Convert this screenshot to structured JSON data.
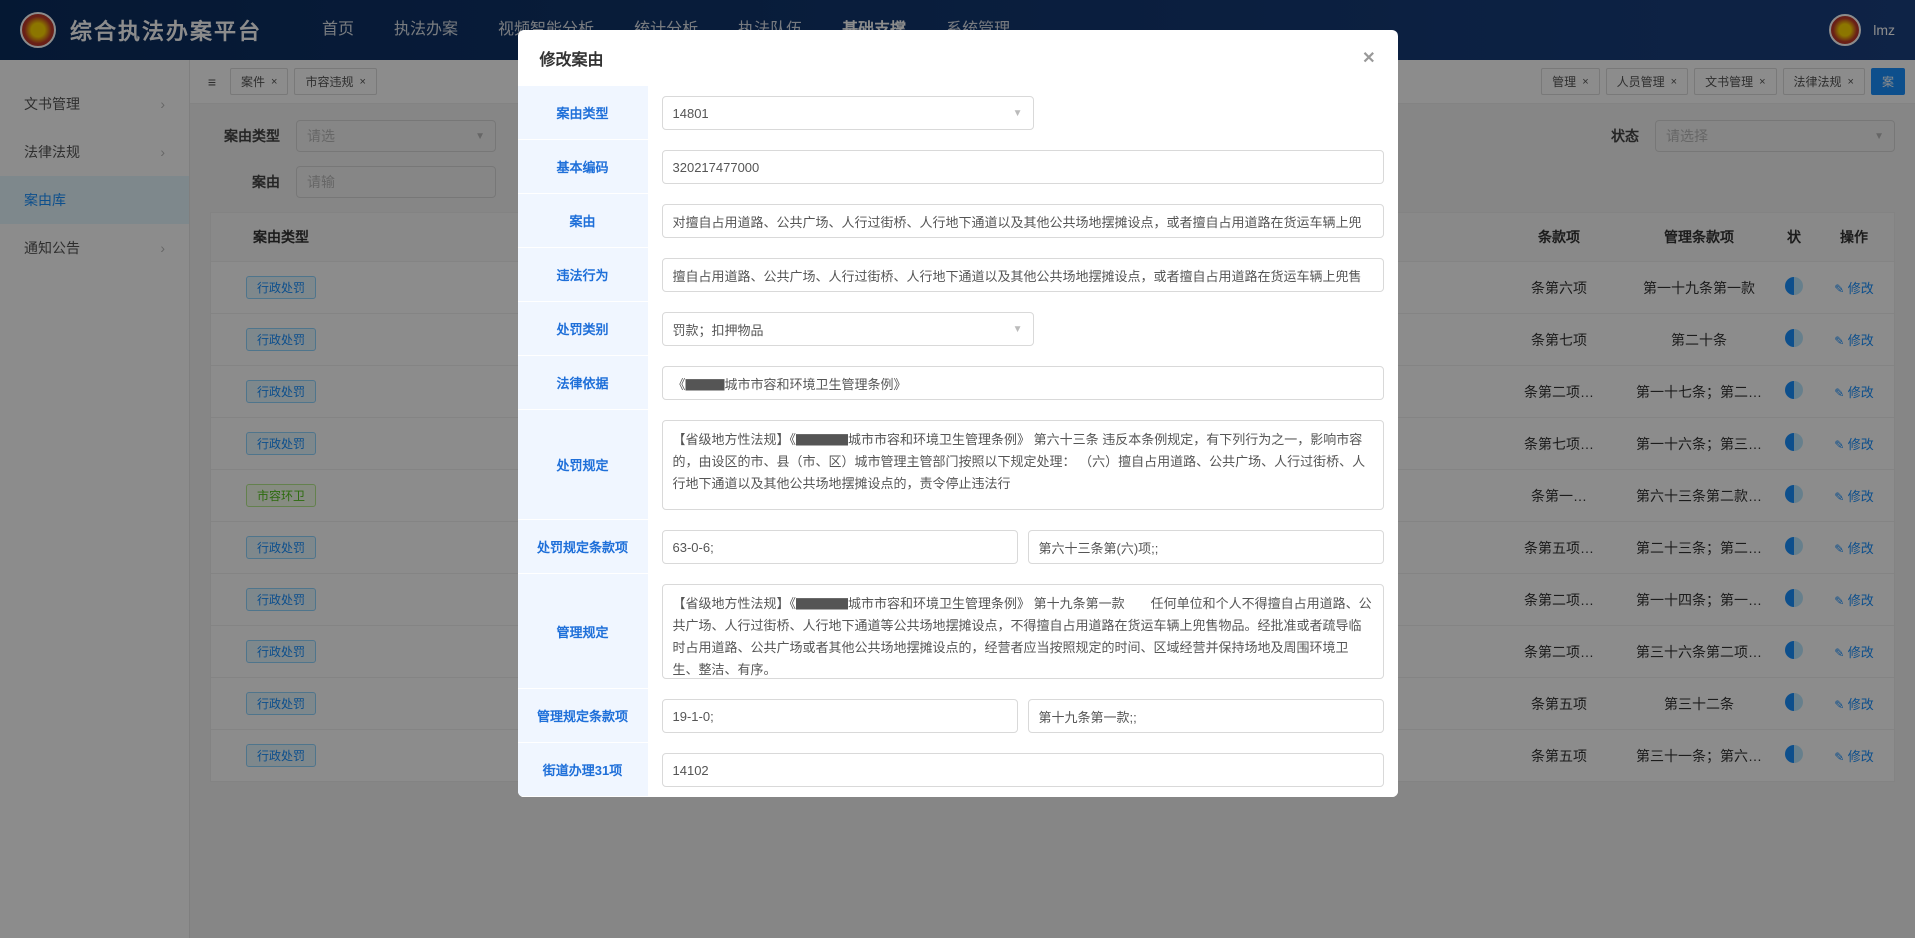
{
  "header": {
    "app_title": "综合执法办案平台",
    "nav": [
      "首页",
      "执法办案",
      "视频智能分析",
      "统计分析",
      "执法队伍",
      "基础支撑",
      "系统管理"
    ],
    "active_nav": 5,
    "user": "lmz"
  },
  "sidebar": {
    "items": [
      {
        "label": "文书管理",
        "has_children": true
      },
      {
        "label": "法律法规",
        "has_children": true
      },
      {
        "label": "案由库",
        "active": true
      },
      {
        "label": "通知公告",
        "has_children": true
      }
    ]
  },
  "tabs": {
    "items": [
      {
        "label": "案件"
      },
      {
        "label": "市容违规"
      },
      {
        "label": "管理"
      },
      {
        "label": "人员管理"
      },
      {
        "label": "文书管理"
      },
      {
        "label": "法律法规"
      },
      {
        "label": "案",
        "active": true
      }
    ]
  },
  "filters": {
    "type_label": "案由类型",
    "type_placeholder": "请选",
    "cause_label": "案由",
    "cause_placeholder": "请输",
    "status_label": "状态",
    "status_placeholder": "请选择"
  },
  "table": {
    "headers": {
      "type": "案由类型",
      "clause": "条款项",
      "mgmt": "管理条款项",
      "flag": "状",
      "op": "操作"
    },
    "rows": [
      {
        "type": "行政处罚",
        "clause": "条第六项",
        "mgmt": "第一十九条第一款",
        "op": "修改"
      },
      {
        "type": "行政处罚",
        "clause": "条第七项",
        "mgmt": "第二十条",
        "op": "修改"
      },
      {
        "type": "行政处罚",
        "clause": "条第二项…",
        "mgmt": "第一十七条；第二…",
        "op": "修改"
      },
      {
        "type": "行政处罚",
        "clause": "条第七项…",
        "mgmt": "第一十六条；第三…",
        "op": "修改"
      },
      {
        "type": "市容环卫",
        "alt": true,
        "clause": "条第一…",
        "mgmt": "第六十三条第二款…",
        "op": "修改"
      },
      {
        "type": "行政处罚",
        "clause": "条第五项…",
        "mgmt": "第二十三条；第二…",
        "op": "修改"
      },
      {
        "type": "行政处罚",
        "clause": "条第二项…",
        "mgmt": "第一十四条；第一…",
        "op": "修改"
      },
      {
        "type": "行政处罚",
        "clause": "条第二项…",
        "mgmt": "第三十六条第二项…",
        "op": "修改"
      },
      {
        "type": "行政处罚",
        "clause": "条第五项",
        "mgmt": "第三十二条",
        "op": "修改"
      },
      {
        "type": "行政处罚",
        "clause": "条第五项",
        "mgmt": "第三十一条；第六…",
        "op": "修改"
      }
    ]
  },
  "modal": {
    "title": "修改案由",
    "fields": {
      "type": {
        "label": "案由类型",
        "value": "14801"
      },
      "code": {
        "label": "基本编码",
        "value": "320217477000"
      },
      "cause": {
        "label": "案由",
        "value": "对擅自占用道路、公共广场、人行过街桥、人行地下通道以及其他公共场地摆摊设点，或者擅自占用道路在货运车辆上兜"
      },
      "illegal": {
        "label": "违法行为",
        "value": "擅自占用道路、公共广场、人行过街桥、人行地下通道以及其他公共场地摆摊设点，或者擅自占用道路在货运车辆上兜售"
      },
      "penalty_type": {
        "label": "处罚类别",
        "value": "罚款；扣押物品"
      },
      "legal_basis": {
        "label": "法律依据",
        "value": "《▇▇▇城市市容和环境卫生管理条例》"
      },
      "penalty_rule": {
        "label": "处罚规定",
        "value": "【省级地方性法规】《▇▇▇▇城市市容和环境卫生管理条例》\n第六十三条 违反本条例规定，有下列行为之一，影响市容的，由设区的市、县（市、区）城市管理主管部门按照以下规定处理：\n（六）擅自占用道路、公共广场、人行过街桥、人行地下通道以及其他公共场地摆摊设点的，责令停止违法行"
      },
      "penalty_clause": {
        "label": "处罚规定条款项",
        "code": "63-0-6;",
        "text": "第六十三条第(六)项;;"
      },
      "mgmt_rule": {
        "label": "管理规定",
        "value": "【省级地方性法规】《▇▇▇▇城市市容和环境卫生管理条例》\n第十九条第一款　　任何单位和个人不得擅自占用道路、公共广场、人行过街桥、人行地下通道等公共场地摆摊设点，不得擅自占用道路在货运车辆上兜售物品。经批准或者疏导临时占用道路、公共广场或者其他公共场地摆摊设点的，经营者应当按照规定的时间、区域经营并保持场地及周围环境卫生、整洁、有序。"
      },
      "mgmt_clause": {
        "label": "管理规定条款项",
        "code": "19-1-0;",
        "text": "第十九条第一款;;"
      },
      "street": {
        "label": "街道办理31项",
        "value": "14102"
      }
    }
  }
}
